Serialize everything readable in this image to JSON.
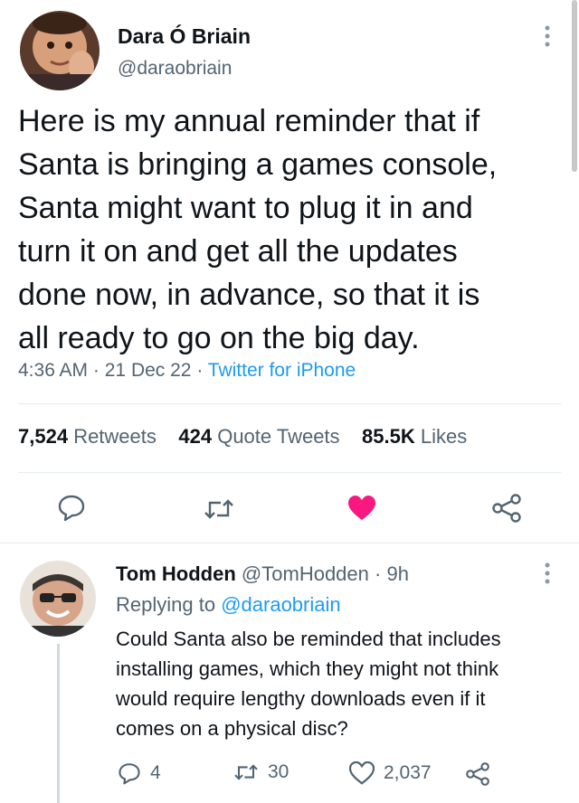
{
  "tweet": {
    "author_name": "Dara Ó Briain",
    "author_handle": "@daraobriain",
    "text_lines": [
      "Here is my annual reminder that if",
      "Santa is bringing a games console,",
      "Santa might want to plug it in and",
      "turn it on and get all the updates",
      "done now, in advance, so that it is",
      "all ready to go on the big day."
    ],
    "time": "4:36 AM",
    "date": "21 Dec 22",
    "source": "Twitter for iPhone",
    "separator": "·",
    "stats": {
      "retweets_count": "7,524",
      "retweets_label": "Retweets",
      "quotes_count": "424",
      "quotes_label": "Quote Tweets",
      "likes_count": "85.5K",
      "likes_label": "Likes"
    },
    "liked": true,
    "like_color": "#f91880"
  },
  "reply": {
    "author_name": "Tom Hodden",
    "author_handle": "@TomHodden",
    "separator": "·",
    "time_ago": "9h",
    "replying_prefix": "Replying to",
    "replying_handle": "@daraobriain",
    "text_lines": [
      "Could Santa also be reminded that includes",
      "installing games, which they might not think",
      "would require lengthy downloads even if it",
      "comes on a physical disc?"
    ],
    "reply_count": "4",
    "retweet_count": "30",
    "like_count": "2,037"
  },
  "icons": {
    "more": "more-vertical-icon",
    "reply": "reply-icon",
    "retweet": "retweet-icon",
    "like": "heart-icon",
    "share": "share-icon"
  },
  "colors": {
    "link": "#1d9bf0",
    "secondary": "#536471",
    "text": "#0f1419"
  }
}
